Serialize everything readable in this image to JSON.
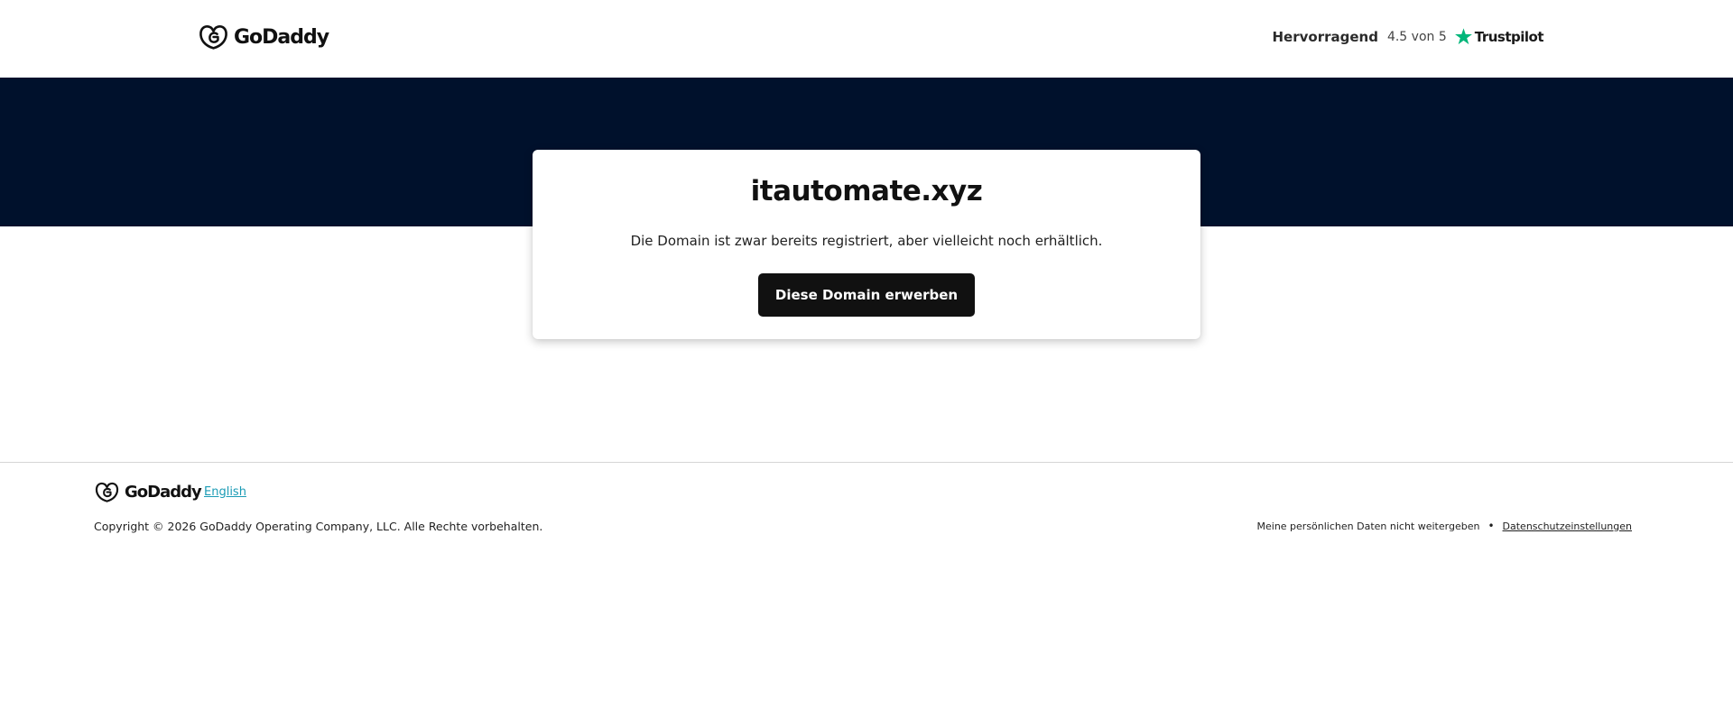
{
  "header": {
    "logo_text": "GoDaddy",
    "rating": {
      "label": "Hervorragend",
      "score": "4.5 von 5",
      "provider": "Trustpilot"
    }
  },
  "card": {
    "domain": "itautomate.xyz",
    "description": "Die Domain ist zwar bereits registriert, aber vielleicht noch erhältlich.",
    "button_label": "Diese Domain erwerben"
  },
  "footer": {
    "logo_text": "GoDaddy",
    "language_link": "English",
    "copyright": "Copyright © 2026 GoDaddy Operating Company, LLC. Alle Rechte vorbehalten.",
    "do_not_share": "Meine persönlichen Daten nicht weitergeben",
    "separator": "•",
    "privacy_settings": "Datenschutzeinstellungen"
  },
  "colors": {
    "hero_background": "#00112c",
    "button_background": "#111111",
    "trustpilot_green": "#00b67a",
    "link_teal": "#1b9bb5"
  },
  "icons": {
    "logo": "godaddy-logo-icon",
    "rating": "trustpilot-star-icon"
  }
}
